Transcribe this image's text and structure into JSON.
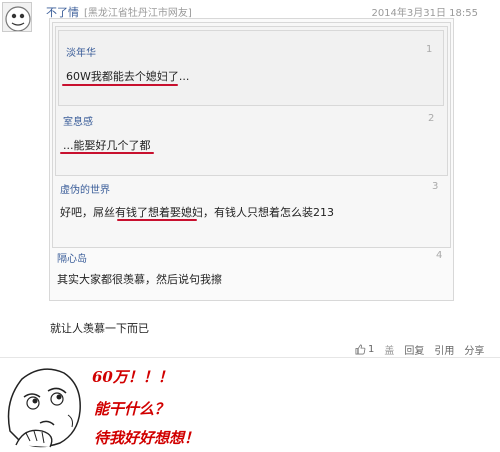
{
  "post": {
    "username": "不了情",
    "location": "[黑龙江省牡丹江市网友]",
    "timestamp": "2014年3月31日  18:55"
  },
  "quotes": [
    {
      "author": "淡年华",
      "floor": "1",
      "text": "60W我都能去个媳妇了..."
    },
    {
      "author": "室息感",
      "floor": "2",
      "text": "...能娶好几个了都"
    },
    {
      "author": "虚伪的世界",
      "floor": "3",
      "text": "好吧，屌丝有钱了想着娶媳妇，有钱人只想着怎么装213"
    },
    {
      "author": "隔心岛",
      "floor": "4",
      "text": "其实大家都很羡慕，然后说句我擦"
    }
  ],
  "reply": {
    "text": "就让人羡慕一下而已"
  },
  "actions": {
    "like_count": "1",
    "reply_label": "回复",
    "quote_label": "回复",
    "wrap": "盖",
    "reply": "回复",
    "quote": "引用",
    "share": "分享"
  },
  "meme": {
    "line1": "60万！！！",
    "line2": "能干什么？",
    "line3": "待我好好想想！"
  },
  "colors": {
    "link": "#3a5d99",
    "underline": "#c8102e",
    "handwriting": "#d10000"
  }
}
